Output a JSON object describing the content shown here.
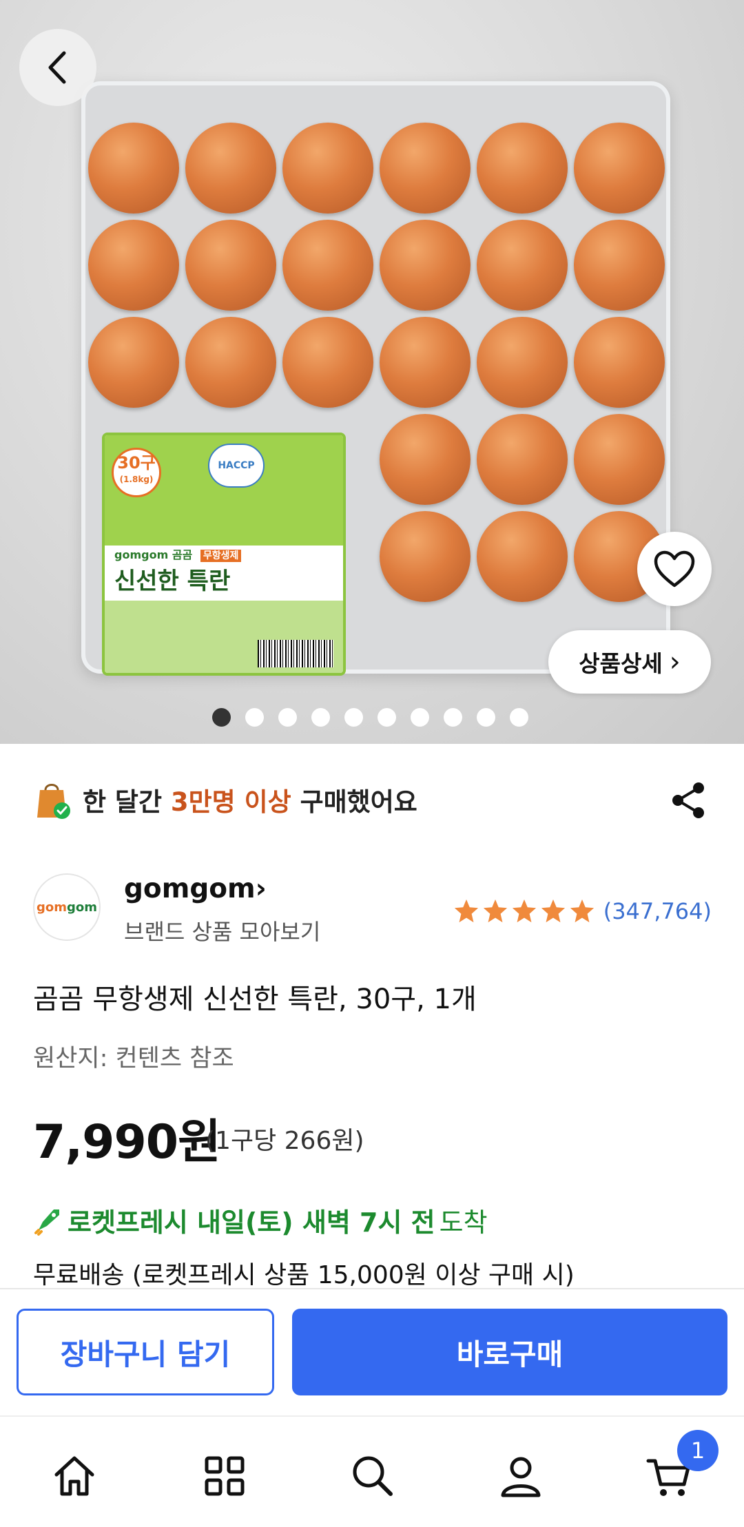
{
  "product_image": {
    "label_count": "30구",
    "label_weight": "(1.8kg)",
    "label_brand": "gomgom",
    "label_brand_kr": "곰곰",
    "label_tag": "무항생제",
    "label_name": "신선한 특란",
    "label_cert": "HACCP"
  },
  "carousel": {
    "total": 10,
    "active": 0
  },
  "detail_button": {
    "label": "상품상세",
    "chevron": "›"
  },
  "purchase_notice": {
    "prefix": "한 달간 ",
    "highlight": "3만명 이상",
    "suffix": " 구매했어요"
  },
  "brand": {
    "logo_text_a": "gom",
    "logo_text_b": "gom",
    "name": "gomgom›",
    "more": "브랜드 상품 모아보기"
  },
  "rating": {
    "stars": 5,
    "count": "(347,764)",
    "color": "#f08a3c"
  },
  "product": {
    "title": "곰곰 무항생제 신선한 특란, 30구, 1개",
    "origin": "원산지: 컨텐츠 참조",
    "price": "7,990원",
    "unit_price": "(1구당 266원)"
  },
  "delivery": {
    "bold_text": "로켓프레시 내일(토) 새벽 7시 전",
    "normal_text": " 도착",
    "free_shipping": "무료배송 (로켓프레시 상품 15,000원 이상 구매 시)"
  },
  "actions": {
    "cart": "장바구니 담기",
    "buy": "바로구매"
  },
  "nav": {
    "cart_badge": "1"
  },
  "colors": {
    "accent": "#3469f0",
    "delivery_green": "#1c8a2e",
    "highlight_orange": "#c9531c"
  }
}
